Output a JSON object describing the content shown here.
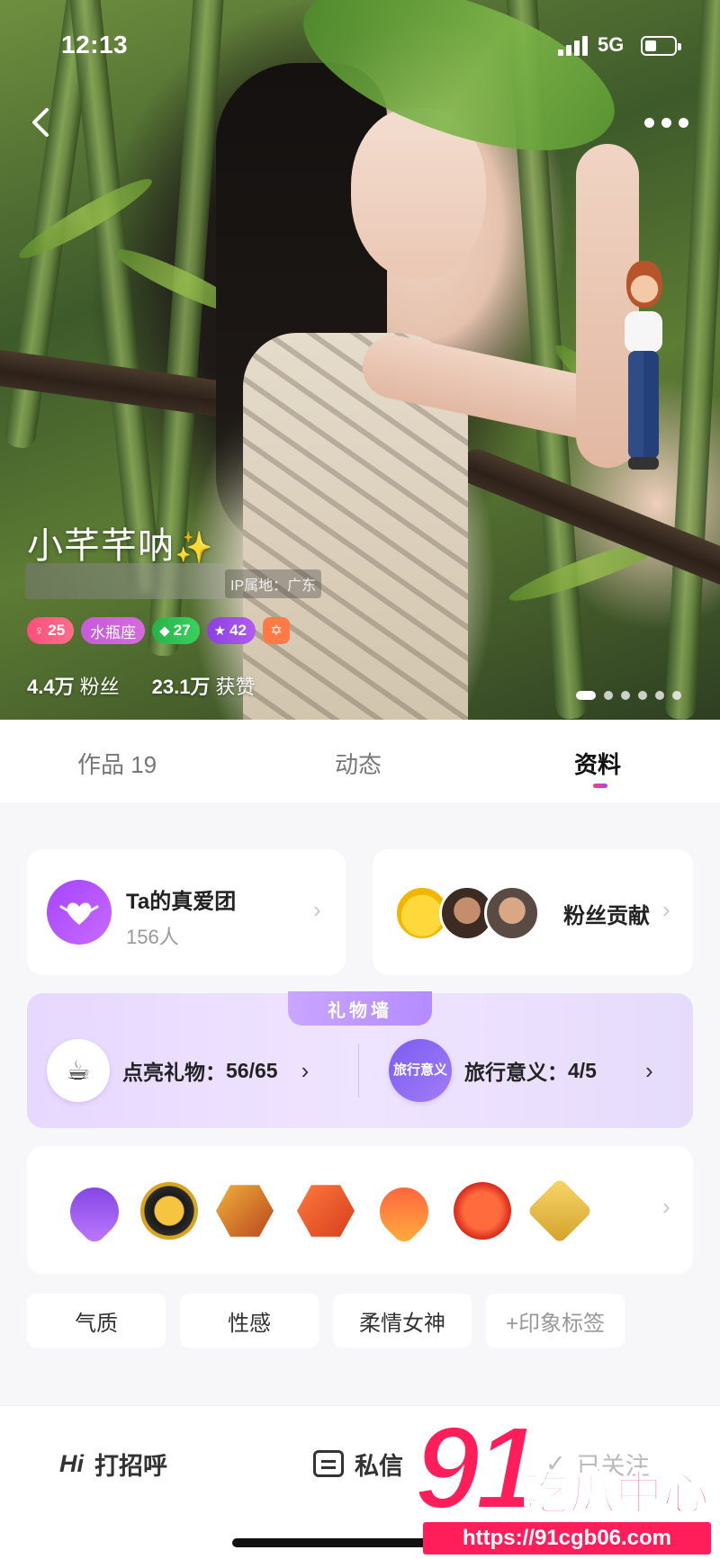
{
  "status": {
    "time": "12:13",
    "network": "5G"
  },
  "profile": {
    "name": "小芊芊呐",
    "sparkle": "✨",
    "ip_location": "IP属地：广东",
    "badges": {
      "level": "25",
      "zodiac": "水瓶座",
      "gem": "27",
      "star": "42"
    },
    "stats": {
      "fans_value": "4.4万",
      "fans_label": "粉丝",
      "likes_value": "23.1万",
      "likes_label": "获赞"
    }
  },
  "tabs": [
    {
      "label": "作品 19"
    },
    {
      "label": "动态"
    },
    {
      "label": "资料"
    }
  ],
  "fans_group": {
    "title": "Ta的真爱团",
    "count": "156人"
  },
  "fan_contribution": {
    "title": "粉丝贡献"
  },
  "gift_wall": {
    "label": "礼物墙",
    "lit_label": "点亮礼物：",
    "lit_value": "56/65",
    "travel_icon_text": "旅行意义",
    "travel_label": "旅行意义：",
    "travel_value": "4/5"
  },
  "impression_tags": [
    "气质",
    "性感",
    "柔情女神",
    "+印象标签"
  ],
  "bottom_bar": {
    "hi": "Hi",
    "greet": "打招呼",
    "message": "私信",
    "followed": "已关注"
  },
  "watermark": {
    "number": "91",
    "text": "吃瓜中心",
    "url": "https://91cgb06.com"
  },
  "colors": {
    "accent_pink": "#ff3b6b",
    "accent_purple": "#a544ff",
    "watermark_red": "#ff1d5a"
  }
}
